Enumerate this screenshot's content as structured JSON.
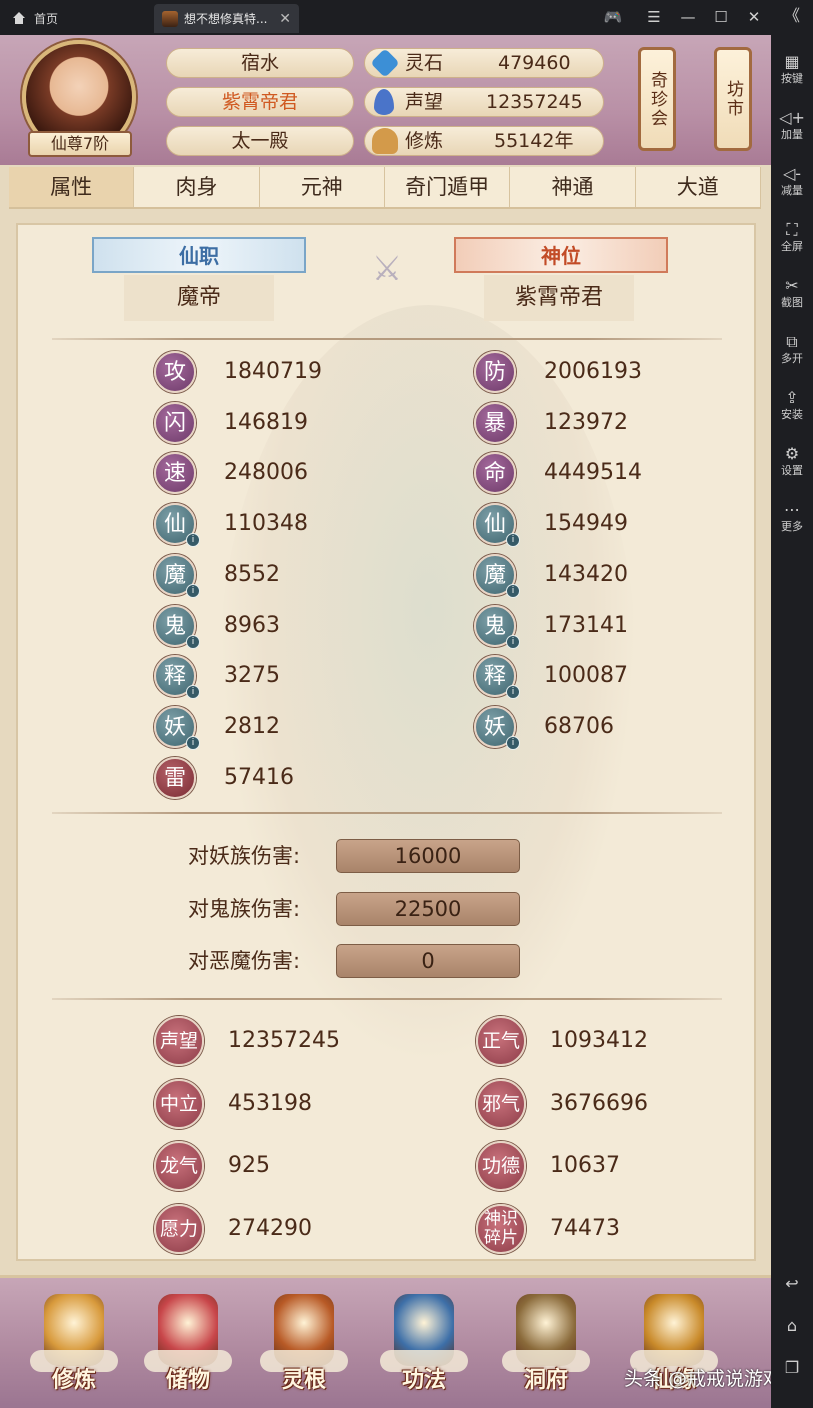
{
  "window": {
    "home_tab": "首页",
    "game_tab": "想不想修真特...",
    "close_glyph": "✕",
    "controls": [
      "🎮",
      "☰",
      "—",
      "☐",
      "✕"
    ]
  },
  "sidebar": [
    {
      "icon": "keyboard-icon",
      "glyph": "▦",
      "label": "按键"
    },
    {
      "icon": "volume-up-icon",
      "glyph": "◁+",
      "label": "加量"
    },
    {
      "icon": "volume-down-icon",
      "glyph": "◁-",
      "label": "减量"
    },
    {
      "icon": "fullscreen-icon",
      "glyph": "⛶",
      "label": "全屏"
    },
    {
      "icon": "scissors-icon",
      "glyph": "✂",
      "label": "截图"
    },
    {
      "icon": "multi-open-icon",
      "glyph": "⧉",
      "label": "多开"
    },
    {
      "icon": "install-icon",
      "glyph": "⇪",
      "label": "安装"
    },
    {
      "icon": "gear-icon",
      "glyph": "⚙",
      "label": "设置"
    },
    {
      "icon": "more-icon",
      "glyph": "⋯",
      "label": "更多"
    }
  ],
  "sidebar_bottom": [
    {
      "icon": "back-icon",
      "glyph": "↩"
    },
    {
      "icon": "home-icon",
      "glyph": "⌂"
    },
    {
      "icon": "recent-apps-icon",
      "glyph": "❐"
    }
  ],
  "collapse_glyph": "《",
  "header": {
    "rank": "仙尊7阶",
    "names": [
      "宿水",
      "紫霄帝君",
      "太一殿"
    ],
    "resources": [
      {
        "icon": "spirit-stone-icon",
        "label": "灵石",
        "value": "479460",
        "color": "#3c8fd6"
      },
      {
        "icon": "reputation-icon",
        "label": "声望",
        "value": "12357245",
        "color": "#4a74c9"
      },
      {
        "icon": "cultivation-icon",
        "label": "修炼",
        "value": "55142年",
        "color": "#d39a4a"
      }
    ],
    "shop_treasure": "奇珍会",
    "shop_market": "坊市"
  },
  "tabs": [
    "属性",
    "肉身",
    "元神",
    "奇门遁甲",
    "神通",
    "大道"
  ],
  "active_tab": "属性",
  "office": {
    "xian_label": "仙职",
    "xian_value": "魔帝",
    "shen_label": "神位",
    "shen_value": "紫霄帝君",
    "crossed_swords_glyph": "⚔"
  },
  "stats_left": [
    {
      "char": "攻",
      "value": "1840719",
      "style": "purple",
      "dot": false
    },
    {
      "char": "闪",
      "value": "146819",
      "style": "purple",
      "dot": false
    },
    {
      "char": "速",
      "value": "248006",
      "style": "purple",
      "dot": false
    },
    {
      "char": "仙",
      "value": "110348",
      "style": "teal",
      "dot": true
    },
    {
      "char": "魔",
      "value": "8552",
      "style": "teal",
      "dot": true
    },
    {
      "char": "鬼",
      "value": "8963",
      "style": "teal",
      "dot": true
    },
    {
      "char": "释",
      "value": "3275",
      "style": "teal",
      "dot": true
    },
    {
      "char": "妖",
      "value": "2812",
      "style": "teal",
      "dot": true
    },
    {
      "char": "雷",
      "value": "57416",
      "style": "red",
      "dot": false
    }
  ],
  "stats_right": [
    {
      "char": "防",
      "value": "2006193",
      "style": "purple",
      "dot": false
    },
    {
      "char": "暴",
      "value": "123972",
      "style": "purple",
      "dot": false
    },
    {
      "char": "命",
      "value": "4449514",
      "style": "purple",
      "dot": false
    },
    {
      "char": "仙",
      "value": "154949",
      "style": "teal",
      "dot": true
    },
    {
      "char": "魔",
      "value": "143420",
      "style": "teal",
      "dot": true
    },
    {
      "char": "鬼",
      "value": "173141",
      "style": "teal",
      "dot": true
    },
    {
      "char": "释",
      "value": "100087",
      "style": "teal",
      "dot": true
    },
    {
      "char": "妖",
      "value": "68706",
      "style": "teal",
      "dot": true
    }
  ],
  "damage": [
    {
      "label": "对妖族伤害:",
      "value": "16000"
    },
    {
      "label": "对鬼族伤害:",
      "value": "22500"
    },
    {
      "label": "对恶魔伤害:",
      "value": "0"
    }
  ],
  "reputation_left": [
    {
      "label": "声望",
      "value": "12357245"
    },
    {
      "label": "中立",
      "value": "453198"
    },
    {
      "label": "龙气",
      "value": "925"
    },
    {
      "label": "愿力",
      "value": "274290"
    }
  ],
  "reputation_right": [
    {
      "label": "正气",
      "value": "1093412"
    },
    {
      "label": "邪气",
      "value": "3676696"
    },
    {
      "label": "功德",
      "value": "10637"
    },
    {
      "label": "神识碎片",
      "value": "74473"
    }
  ],
  "bottom_nav": [
    {
      "label": "修炼",
      "icon": "meditating-monk-icon",
      "color": "#d89a3c"
    },
    {
      "label": "储物",
      "icon": "storage-bag-icon",
      "color": "#c8464a"
    },
    {
      "label": "灵根",
      "icon": "spirit-root-icon",
      "color": "#b85a26"
    },
    {
      "label": "功法",
      "icon": "scripture-book-icon",
      "color": "#3d6fa8"
    },
    {
      "label": "洞府",
      "icon": "cave-palace-icon",
      "color": "#8a6a3a"
    },
    {
      "label": "仙缘",
      "icon": "gourd-icon",
      "color": "#c98a2a"
    }
  ],
  "watermark": "头条 @戒戒说游戏"
}
